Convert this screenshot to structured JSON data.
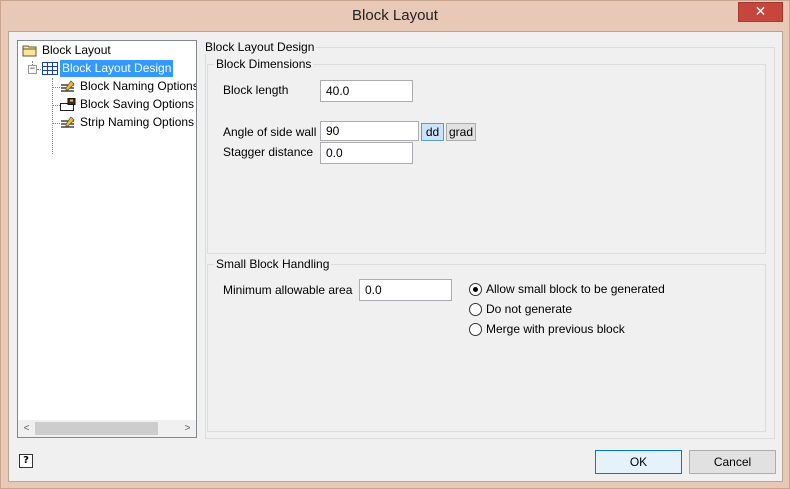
{
  "window": {
    "title": "Block Layout",
    "close_glyph": "✕"
  },
  "tree": {
    "root": {
      "label": "Block Layout",
      "icon": "folder-icon"
    },
    "items": [
      {
        "label": "Block Layout Design",
        "icon": "grid-icon",
        "selected": true,
        "expander": "−"
      },
      {
        "label": "Block Naming Options",
        "icon": "naming-icon"
      },
      {
        "label": "Block Saving Options",
        "icon": "saving-icon"
      },
      {
        "label": "Strip Naming Options",
        "icon": "strip-naming-icon"
      }
    ],
    "scroll_left": "<",
    "scroll_right": ">"
  },
  "design_group": {
    "title": "Block Layout Design"
  },
  "dimensions": {
    "title": "Block Dimensions",
    "block_length_label": "Block length",
    "block_length_value": "40.0",
    "angle_label": "Angle of side wall",
    "angle_value": "90",
    "unit_dd": "dd",
    "unit_grad": "grad",
    "stagger_label": "Stagger distance",
    "stagger_value": "0.0"
  },
  "small_block": {
    "title": "Small Block Handling",
    "min_area_label": "Minimum allowable area",
    "min_area_value": "0.0",
    "options": [
      {
        "label": "Allow small block to be generated",
        "checked": true
      },
      {
        "label": "Do not generate",
        "checked": false
      },
      {
        "label": "Merge with previous block",
        "checked": false
      }
    ]
  },
  "footer": {
    "ok_label": "OK",
    "cancel_label": "Cancel",
    "help_glyph": "?"
  }
}
